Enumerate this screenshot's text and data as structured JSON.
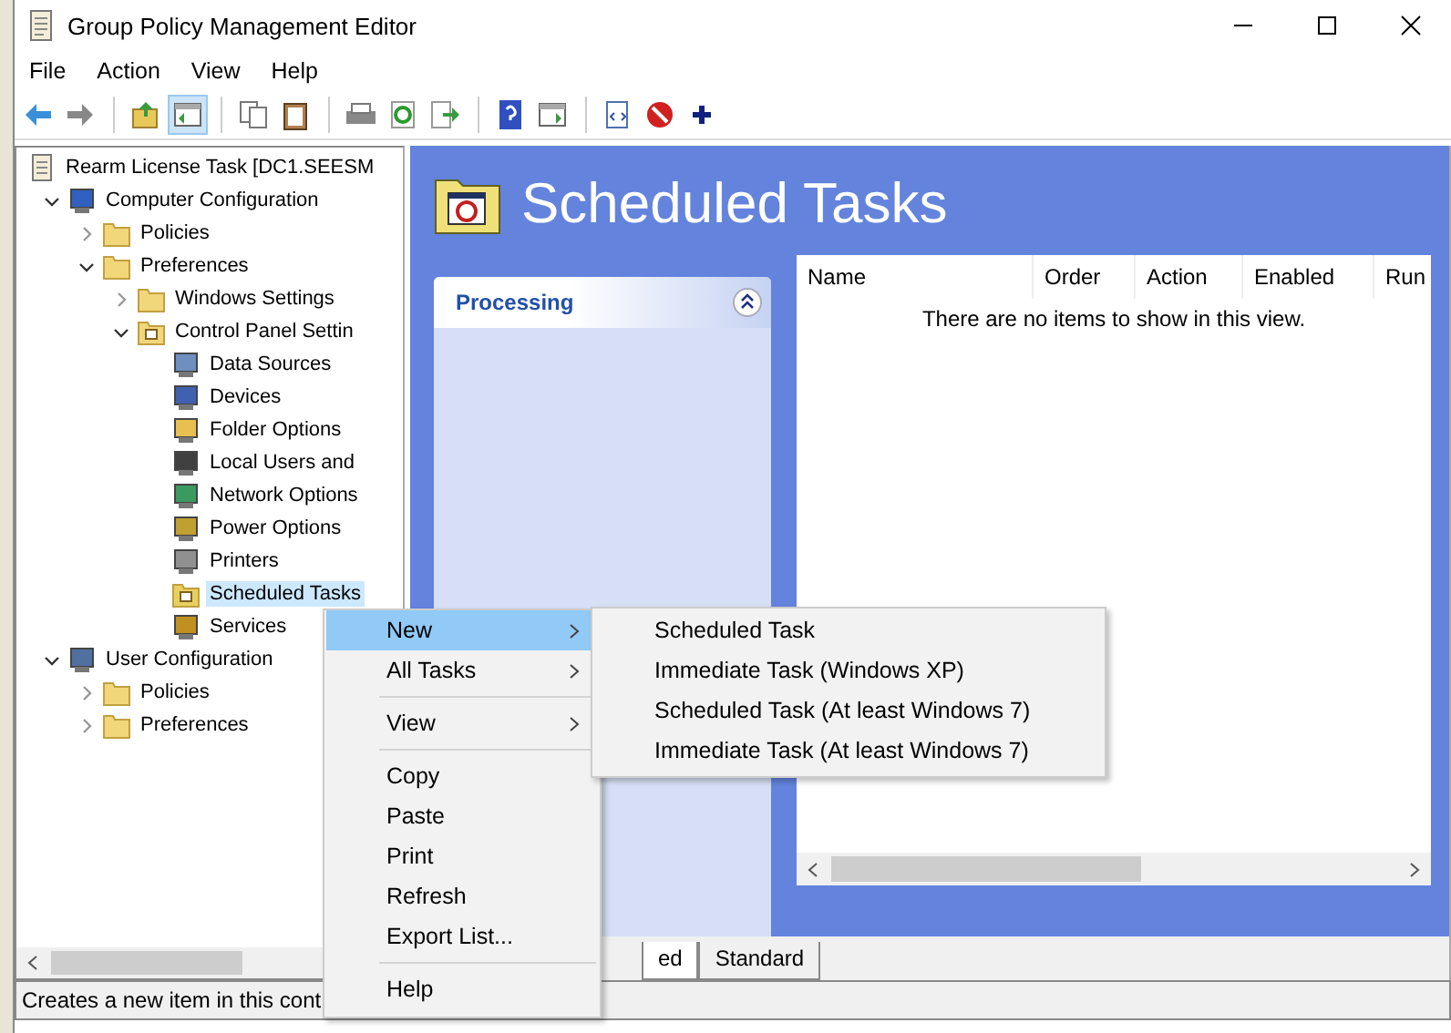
{
  "window": {
    "title": "Group Policy Management Editor"
  },
  "menu_bar": [
    "File",
    "Action",
    "View",
    "Help"
  ],
  "toolbar": [
    {
      "kind": "back",
      "pressed": false
    },
    {
      "kind": "forward",
      "pressed": false
    },
    {
      "kind": "sep"
    },
    {
      "kind": "up-folder",
      "pressed": false
    },
    {
      "kind": "pane",
      "pressed": true
    },
    {
      "kind": "sep"
    },
    {
      "kind": "copy",
      "pressed": false
    },
    {
      "kind": "paste",
      "pressed": false
    },
    {
      "kind": "sep"
    },
    {
      "kind": "print",
      "pressed": false
    },
    {
      "kind": "refresh",
      "pressed": false
    },
    {
      "kind": "export",
      "pressed": false
    },
    {
      "kind": "sep"
    },
    {
      "kind": "help",
      "pressed": false
    },
    {
      "kind": "pane-right",
      "pressed": false
    },
    {
      "kind": "sep"
    },
    {
      "kind": "xml",
      "pressed": false
    },
    {
      "kind": "stop",
      "pressed": false
    },
    {
      "kind": "plus",
      "pressed": false
    }
  ],
  "tree": [
    {
      "label": "Rearm License Task [DC1.SEESM",
      "kind": "scroll",
      "selected": false,
      "children": [
        {
          "label": "Computer Configuration",
          "kind": "computer",
          "expanded": true,
          "selected": false,
          "children": [
            {
              "label": "Policies",
              "kind": "folder",
              "expanded": false,
              "selected": false
            },
            {
              "label": "Preferences",
              "kind": "folder",
              "expanded": true,
              "selected": false,
              "children": [
                {
                  "label": "Windows Settings",
                  "kind": "folder",
                  "expanded": false,
                  "selected": false
                },
                {
                  "label": "Control Panel Settin",
                  "kind": "cp-folder",
                  "expanded": true,
                  "selected": false,
                  "children": [
                    {
                      "label": "Data Sources",
                      "kind": "data",
                      "selected": false
                    },
                    {
                      "label": "Devices",
                      "kind": "device",
                      "selected": false
                    },
                    {
                      "label": "Folder Options",
                      "kind": "folder-opt",
                      "selected": false
                    },
                    {
                      "label": "Local Users and",
                      "kind": "users",
                      "selected": false
                    },
                    {
                      "label": "Network Options",
                      "kind": "network",
                      "selected": false
                    },
                    {
                      "label": "Power Options",
                      "kind": "power",
                      "selected": false
                    },
                    {
                      "label": "Printers",
                      "kind": "printer",
                      "selected": false
                    },
                    {
                      "label": "Scheduled Tasks",
                      "kind": "task",
                      "selected": true
                    },
                    {
                      "label": "Services",
                      "kind": "gear",
                      "selected": false
                    }
                  ]
                }
              ]
            }
          ]
        },
        {
          "label": "User Configuration",
          "kind": "user",
          "expanded": true,
          "selected": false,
          "children": [
            {
              "label": "Policies",
              "kind": "folder",
              "expanded": false,
              "selected": false
            },
            {
              "label": "Preferences",
              "kind": "folder",
              "expanded": false,
              "selected": false
            }
          ]
        }
      ]
    }
  ],
  "details": {
    "title": "Scheduled Tasks",
    "processing_panel": {
      "title": "Processing",
      "expanded": true
    },
    "list": {
      "columns": [
        "Name",
        "Order",
        "Action",
        "Enabled",
        "Run"
      ],
      "empty_message": "There are no items to show in this view."
    }
  },
  "bottom_tabs": [
    {
      "label": "ed",
      "selected": true
    },
    {
      "label": "Standard",
      "selected": false
    }
  ],
  "context_menu": [
    {
      "kind": "item",
      "label": "New",
      "submenu": true,
      "highlighted": true
    },
    {
      "kind": "item",
      "label": "All Tasks",
      "submenu": true,
      "highlighted": false
    },
    {
      "kind": "separator"
    },
    {
      "kind": "item",
      "label": "View",
      "submenu": true,
      "highlighted": false
    },
    {
      "kind": "separator"
    },
    {
      "kind": "item",
      "label": "Copy",
      "submenu": false,
      "highlighted": false
    },
    {
      "kind": "item",
      "label": "Paste",
      "submenu": false,
      "highlighted": false
    },
    {
      "kind": "item",
      "label": "Print",
      "submenu": false,
      "highlighted": false
    },
    {
      "kind": "item",
      "label": "Refresh",
      "submenu": false,
      "highlighted": false
    },
    {
      "kind": "item",
      "label": "Export List...",
      "submenu": false,
      "highlighted": false
    },
    {
      "kind": "separator"
    },
    {
      "kind": "item",
      "label": "Help",
      "submenu": false,
      "highlighted": false
    }
  ],
  "submenu": [
    "Scheduled Task",
    "Immediate Task (Windows XP)",
    "Scheduled Task (At least Windows 7)",
    "Immediate Task (At least Windows 7)"
  ],
  "status_bar": "Creates a new item in this cont"
}
